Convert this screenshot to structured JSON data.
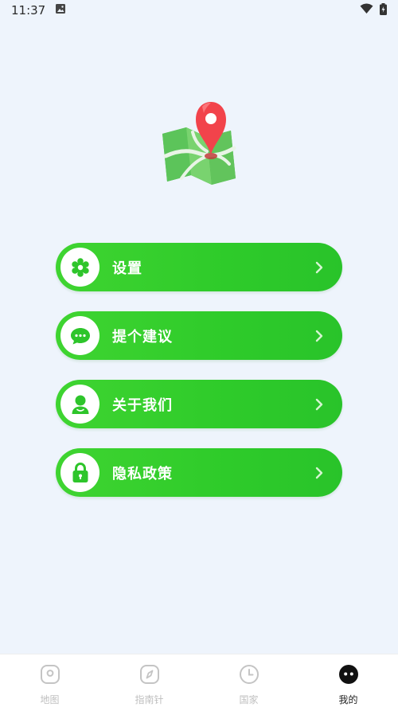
{
  "status_bar": {
    "time": "11:37"
  },
  "menu": [
    {
      "label": "设置"
    },
    {
      "label": "提个建议"
    },
    {
      "label": "关于我们"
    },
    {
      "label": "隐私政策"
    }
  ],
  "bottom_nav": {
    "tabs": [
      {
        "label": "地图",
        "active": false
      },
      {
        "label": "指南针",
        "active": false
      },
      {
        "label": "国家",
        "active": false
      },
      {
        "label": "我的",
        "active": true
      }
    ]
  },
  "colors": {
    "accent_green": "#33cc2e",
    "inactive": "#bfbfbf",
    "active": "#222222"
  }
}
